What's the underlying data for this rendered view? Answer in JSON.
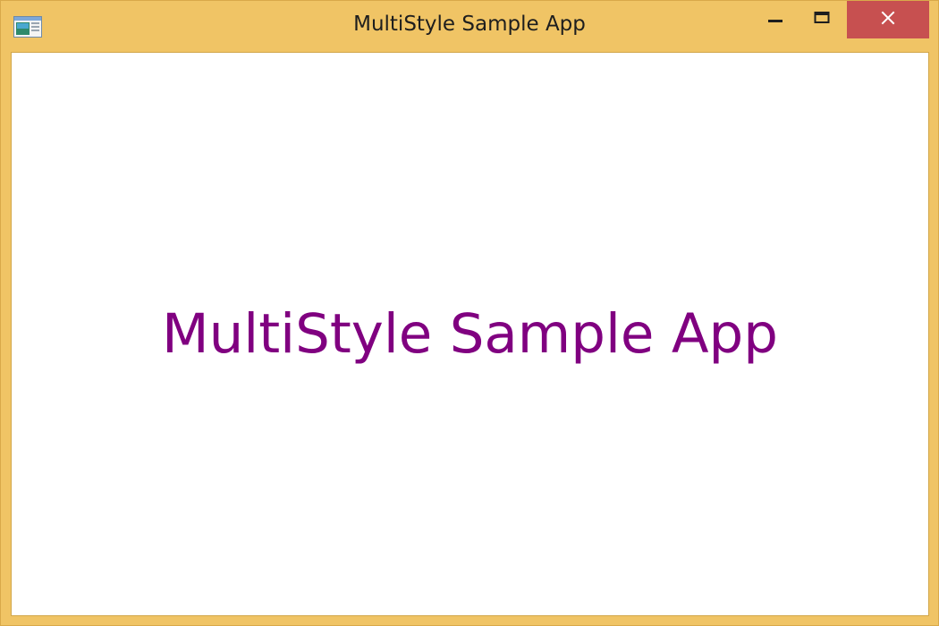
{
  "window": {
    "title": "MultiStyle Sample App"
  },
  "content": {
    "headline": "MultiStyle Sample App"
  },
  "icons": {
    "app": "app-window-icon",
    "minimize": "minimize-icon",
    "maximize": "maximize-icon",
    "close": "close-icon"
  },
  "colors": {
    "frame": "#f0c465",
    "close_button": "#c75050",
    "headline_text": "#800080",
    "client_background": "#ffffff"
  }
}
